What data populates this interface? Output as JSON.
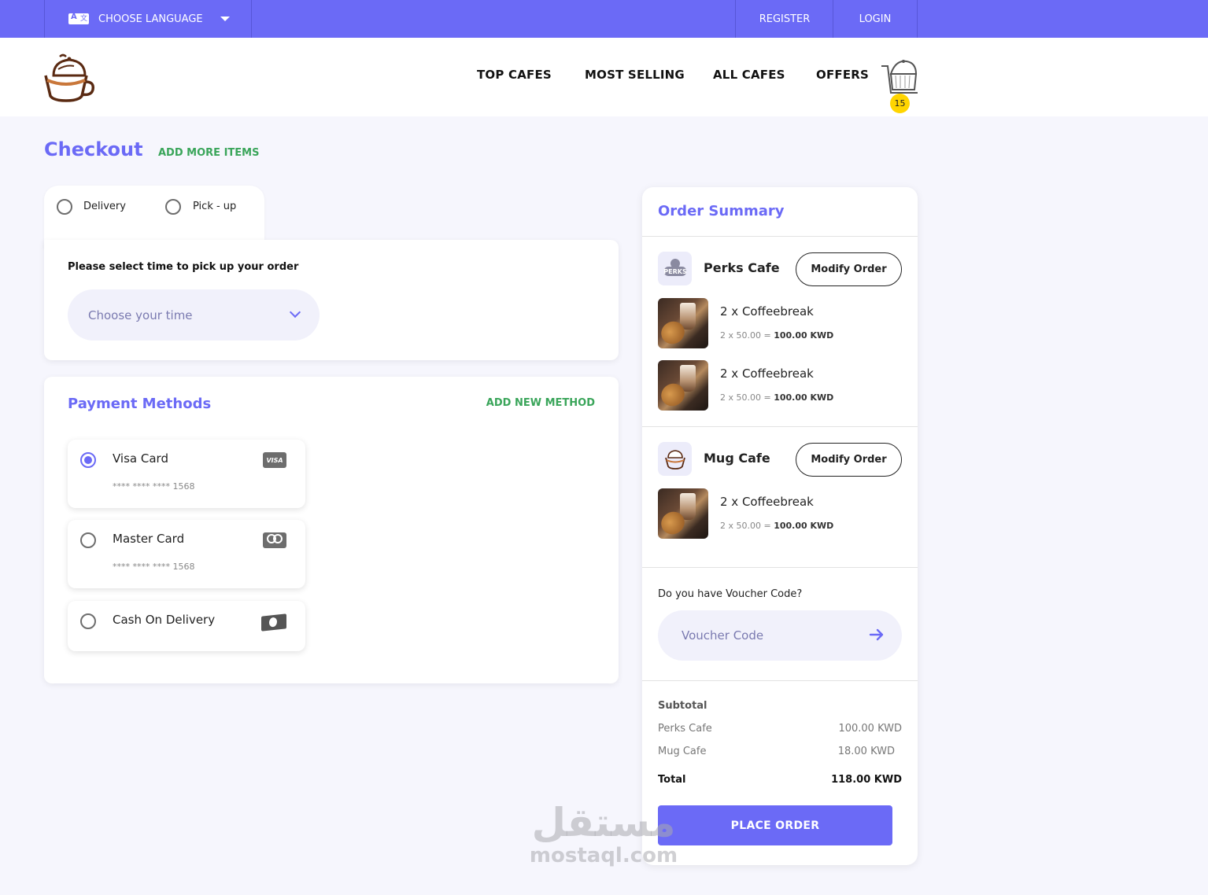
{
  "topbar": {
    "language_label": "CHOOSE LANGUAGE",
    "register": "REGISTER",
    "login": "LOGIN"
  },
  "nav": {
    "items": [
      "TOP CAFES",
      "MOST SELLING",
      "ALL CAFES",
      "OFFERS"
    ],
    "cart_count": "15"
  },
  "page": {
    "title": "Checkout",
    "add_more": "ADD MORE ITEMS"
  },
  "fulfillment": {
    "options": [
      "Delivery",
      "Pick - up"
    ],
    "time_label": "Please select time to pick up your order",
    "time_placeholder": "Choose your time"
  },
  "payment": {
    "title": "Payment Methods",
    "add_new": "ADD NEW METHOD",
    "methods": [
      {
        "name": "Visa Card",
        "number": "**** **** **** 1568",
        "icon": "visa-icon",
        "icon_text": "VISA",
        "selected": true
      },
      {
        "name": "Master Card",
        "number": "**** **** **** 1568",
        "icon": "mastercard-icon",
        "selected": false
      },
      {
        "name": "Cash On Delivery",
        "number": "",
        "icon": "cash-icon",
        "selected": false
      }
    ]
  },
  "summary": {
    "title": "Order Summary",
    "modify_label": "Modify Order",
    "cafes": [
      {
        "name": "Perks Cafe",
        "logo_text": "PERKS",
        "items": [
          {
            "name": "2 x Coffeebreak",
            "calc": "2 x 50.00 = ",
            "total": "100.00 KWD"
          },
          {
            "name": "2 x Coffeebreak",
            "calc": "2 x 50.00 = ",
            "total": "100.00 KWD"
          }
        ]
      },
      {
        "name": "Mug Cafe",
        "items": [
          {
            "name": "2 x Coffeebreak",
            "calc": "2 x 50.00 = ",
            "total": "100.00 KWD"
          }
        ]
      }
    ],
    "voucher_label": "Do you have Voucher Code?",
    "voucher_placeholder": "Voucher Code",
    "subtotal_title": "Subtotal",
    "subtotal_rows": [
      {
        "label": "Perks Cafe",
        "value": "100.00 KWD"
      },
      {
        "label": "Mug Cafe",
        "value": "18.00 KWD"
      }
    ],
    "total_label": "Total",
    "total_value": "118.00 KWD",
    "place_order": "PLACE ORDER"
  },
  "watermark": {
    "arabic": "مستقل",
    "latin": "mostaql.com"
  },
  "colors": {
    "accent": "#6b6af6",
    "green": "#3aa55a",
    "badge": "#ffd500"
  }
}
